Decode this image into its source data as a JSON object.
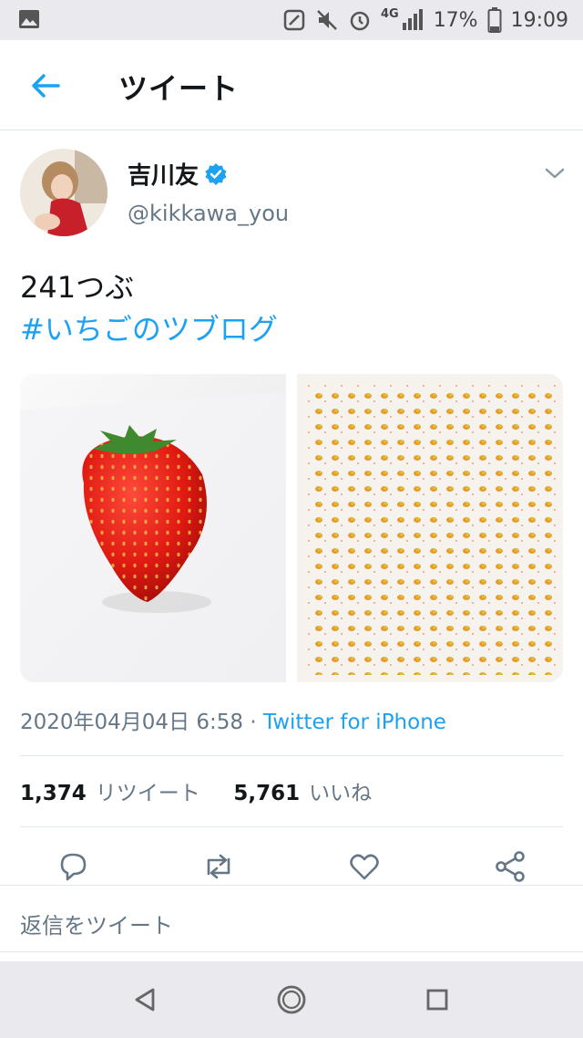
{
  "status_bar": {
    "network": "4G",
    "battery": "17%",
    "time": "19:09",
    "icons": [
      "image-icon",
      "nfc-icon",
      "mute-icon",
      "alarm-icon",
      "signal-icon",
      "battery-icon"
    ]
  },
  "header": {
    "title": "ツイート",
    "back_icon": "back-arrow-icon"
  },
  "tweet": {
    "author_name": "吉川友",
    "verified": true,
    "handle": "@kikkawa_you",
    "text_line1": "241つぶ",
    "hashtag": "#いちごのツブログ",
    "date_time": "2020年04月04日 6:58",
    "separator": "·",
    "source": "Twitter for iPhone",
    "retweets_count": "1,374",
    "retweets_label": "リツイート",
    "likes_count": "5,761",
    "likes_label": "いいね"
  },
  "actions": [
    "reply-icon",
    "retweet-icon",
    "like-icon",
    "share-icon"
  ],
  "reply_placeholder": "返信をツイート",
  "colors": {
    "accent": "#1da1f2",
    "secondary_text": "#657786",
    "text": "#14171a"
  }
}
